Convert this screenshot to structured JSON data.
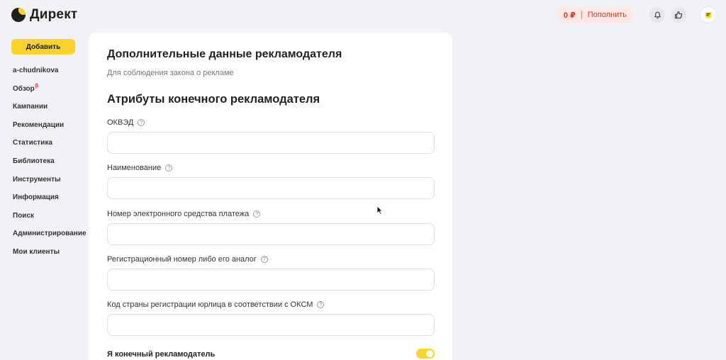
{
  "brand": {
    "name": "Директ"
  },
  "header": {
    "balance": "0 ₽",
    "topup_label": "Пополнить"
  },
  "sidebar": {
    "add_label": "Добавить",
    "items": [
      {
        "label": "a-chudnikova"
      },
      {
        "label": "Обзор",
        "badge": "β"
      },
      {
        "label": "Кампании"
      },
      {
        "label": "Рекомендации"
      },
      {
        "label": "Статистика"
      },
      {
        "label": "Библиотека"
      },
      {
        "label": "Инструменты"
      },
      {
        "label": "Информация"
      },
      {
        "label": "Поиск"
      },
      {
        "label": "Администрирование"
      },
      {
        "label": "Мои клиенты"
      }
    ]
  },
  "form": {
    "title": "Дополнительные данные рекламодателя",
    "subtitle": "Для соблюдения закона о рекламе",
    "section_title": "Атрибуты конечного рекламодателя",
    "fields": [
      {
        "label": "ОКВЭД",
        "value": ""
      },
      {
        "label": "Наименование",
        "value": ""
      },
      {
        "label": "Номер электронного средства платежа",
        "value": ""
      },
      {
        "label": "Регистрационный номер либо его аналог",
        "value": ""
      },
      {
        "label": "Код страны регистрации юрлица в соответствии с ОКСМ",
        "value": ""
      }
    ],
    "toggle": {
      "label": "Я конечный рекламодатель",
      "on": true
    }
  },
  "icons": {
    "help": "?",
    "bell": "bell-icon",
    "like": "thumbs-up-icon",
    "avatar": "avatar-icon"
  },
  "colors": {
    "accent": "#fcd22d",
    "balance": "#e0301e"
  }
}
